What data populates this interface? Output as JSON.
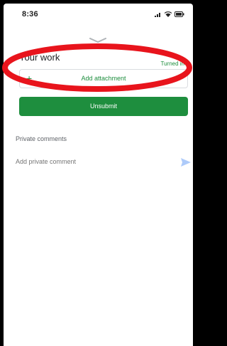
{
  "status_bar": {
    "time": "8:36",
    "icons": [
      "signal-icon",
      "wifi-icon",
      "battery-icon"
    ]
  },
  "sheet": {
    "handle_icon": "chevron-down-icon",
    "section_title": "Your work",
    "status_label": "Turned in",
    "attach_button": {
      "icon": "plus-icon",
      "plus_glyph": "+",
      "label": "Add attachment"
    },
    "submit_button": {
      "label": "Unsubmit"
    }
  },
  "private_comments": {
    "title": "Private comments",
    "input_placeholder": "Add private comment",
    "send_icon": "send-icon"
  },
  "annotation": {
    "shape": "ellipse",
    "color": "#e8141c"
  },
  "colors": {
    "accent": "#1e8e3e",
    "frame": "#000000"
  }
}
